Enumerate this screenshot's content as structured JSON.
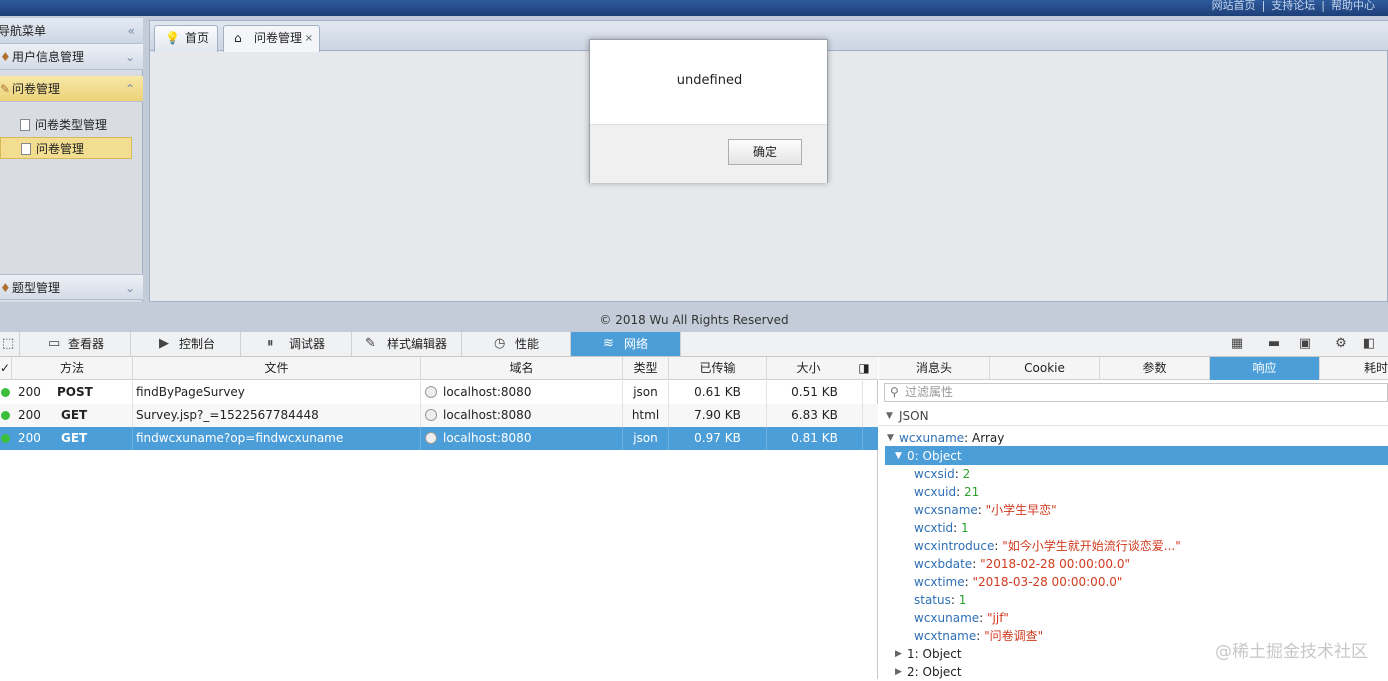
{
  "top": {
    "links": [
      "网站首页",
      "支持论坛",
      "帮助中心"
    ],
    "separator": "|"
  },
  "sidebar": {
    "title": "导航菜单",
    "collapse_icon": "«",
    "groups": [
      {
        "label": "用户信息管理"
      },
      {
        "label": "问卷管理",
        "active": true
      },
      {
        "label": "题型管理"
      }
    ],
    "sub_items": [
      {
        "label": "问卷类型管理"
      },
      {
        "label": "问卷管理",
        "active": true
      }
    ]
  },
  "tabs": [
    {
      "label": "首页"
    },
    {
      "label": "问卷管理",
      "close": "×"
    }
  ],
  "dialog": {
    "message": "undefined",
    "ok_label": "确定"
  },
  "footer": {
    "text": "© 2018 Wu All Rights Reserved"
  },
  "devtools": {
    "tools": [
      {
        "label": "查看器",
        "icon": "inspector-icon"
      },
      {
        "label": "控制台",
        "icon": "console-icon"
      },
      {
        "label": "调试器",
        "icon": "debugger-icon"
      },
      {
        "label": "样式编辑器",
        "icon": "style-editor-icon"
      },
      {
        "label": "性能",
        "icon": "performance-icon"
      },
      {
        "label": "网络",
        "icon": "network-icon",
        "active": true
      }
    ],
    "network": {
      "columns": [
        "✓",
        "方法",
        "文件",
        "域名",
        "类型",
        "已传输",
        "大小"
      ],
      "rows": [
        {
          "status": "200",
          "method": "POST",
          "file": "findByPageSurvey",
          "domain": "localhost:8080",
          "type": "json",
          "transferred": "0.61 KB",
          "size": "0.51 KB"
        },
        {
          "status": "200",
          "method": "GET",
          "file": "Survey.jsp?_=1522567784448",
          "domain": "localhost:8080",
          "type": "html",
          "transferred": "7.90 KB",
          "size": "6.83 KB"
        },
        {
          "status": "200",
          "method": "GET",
          "file": "findwcxuname?op=findwcxuname",
          "domain": "localhost:8080",
          "type": "json",
          "transferred": "0.97 KB",
          "size": "0.81 KB",
          "selected": true
        }
      ]
    },
    "details": {
      "tabs": [
        "消息头",
        "Cookie",
        "参数",
        "响应",
        "耗时"
      ],
      "active_tab": "响应",
      "filter_placeholder": "过滤属性",
      "json_label": "JSON",
      "root": {
        "key": "wcxuname",
        "type": "Array"
      },
      "item0": {
        "key": "0",
        "type": "Object"
      },
      "fields": [
        {
          "key": "wcxsid",
          "value": "2",
          "kind": "number"
        },
        {
          "key": "wcxuid",
          "value": "21",
          "kind": "number"
        },
        {
          "key": "wcxsname",
          "value": "\"小学生早恋\"",
          "kind": "string"
        },
        {
          "key": "wcxtid",
          "value": "1",
          "kind": "number"
        },
        {
          "key": "wcxintroduce",
          "value": "\"如今小学生就开始流行谈恋爱...\"",
          "kind": "string"
        },
        {
          "key": "wcxbdate",
          "value": "\"2018-02-28 00:00:00.0\"",
          "kind": "string"
        },
        {
          "key": "wcxtime",
          "value": "\"2018-03-28 00:00:00.0\"",
          "kind": "string"
        },
        {
          "key": "status",
          "value": "1",
          "kind": "number"
        },
        {
          "key": "wcxuname",
          "value": "\"jjf\"",
          "kind": "string"
        },
        {
          "key": "wcxtname",
          "value": "\"问卷调查\"",
          "kind": "string"
        }
      ],
      "more": [
        {
          "key": "1",
          "type": "Object"
        },
        {
          "key": "2",
          "type": "Object"
        }
      ]
    }
  },
  "watermark": "@稀土掘金技术社区"
}
